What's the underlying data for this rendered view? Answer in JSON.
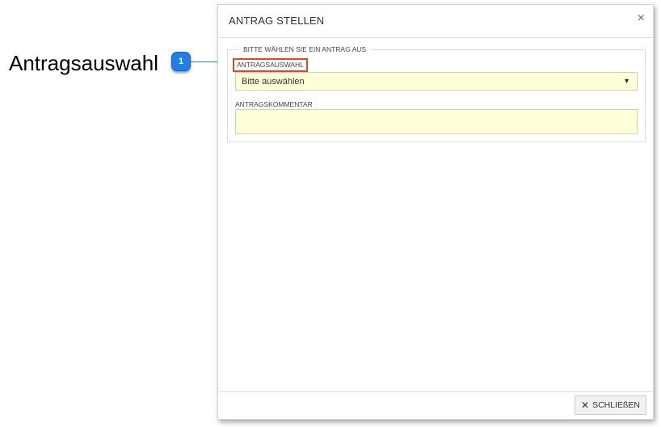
{
  "annotation": {
    "label": "Antragsauswahl",
    "badge": "1"
  },
  "dialog": {
    "title": "ANTRAG STELLEN",
    "close_glyph": "×",
    "fieldset": {
      "legend": "BITTE WÄHLEN SIE EIN ANTRAG AUS",
      "select_label": "ANTRAGSAUSWAHL",
      "select_value": "Bitte auswählen",
      "select_arrow": "▼",
      "comment_label": "ANTRAGSKOMMENTAR",
      "comment_value": ""
    },
    "footer": {
      "close_label": "SCHLIEßEN",
      "close_icon": "✕"
    }
  },
  "colors": {
    "badge": "#1f7fe6",
    "highlight_border": "#e0462a",
    "field_background": "#ffffd8"
  }
}
